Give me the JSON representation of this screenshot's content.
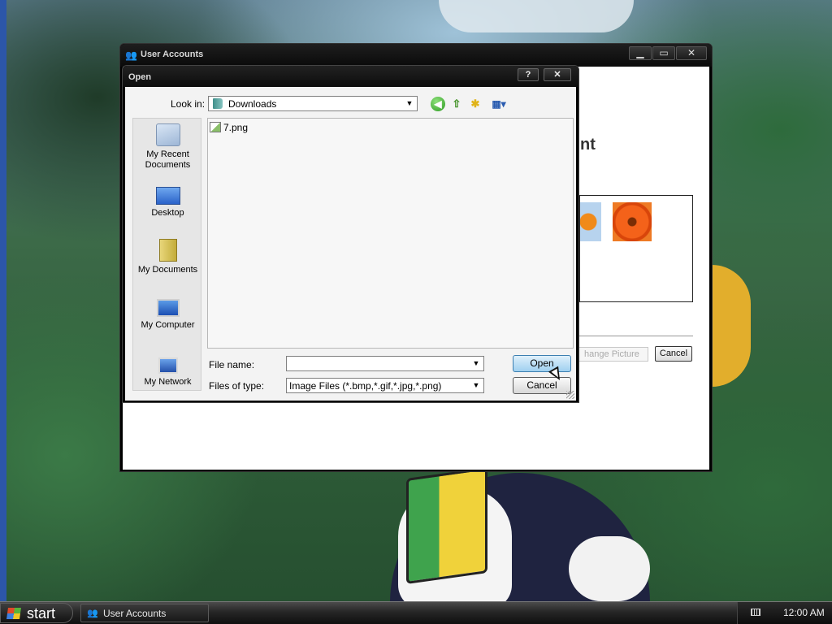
{
  "user_accounts_window": {
    "title": "User Accounts",
    "heading_fragment": "nt",
    "change_picture_label": "hange Picture",
    "cancel_label": "Cancel"
  },
  "open_dialog": {
    "title": "Open",
    "help_label": "?",
    "close_label": "✕",
    "look_in_label": "Look in:",
    "look_in_value": "Downloads",
    "places": [
      {
        "label": "My Recent Documents",
        "icon": "recent-documents-icon"
      },
      {
        "label": "Desktop",
        "icon": "desktop-icon"
      },
      {
        "label": "My Documents",
        "icon": "my-documents-icon"
      },
      {
        "label": "My Computer",
        "icon": "my-computer-icon"
      },
      {
        "label": "My Network",
        "icon": "my-network-icon"
      }
    ],
    "files": [
      {
        "name": "7.png",
        "icon": "image-file-icon"
      }
    ],
    "file_name_label": "File name:",
    "file_name_value": "",
    "files_of_type_label": "Files of type:",
    "files_of_type_value": "Image Files (*.bmp,*.gif,*.jpg,*.png)",
    "open_button_label": "Open",
    "cancel_button_label": "Cancel"
  },
  "taskbar": {
    "start_label": "start",
    "tasks": [
      {
        "label": "User Accounts"
      }
    ],
    "clock": "12:00 AM"
  }
}
